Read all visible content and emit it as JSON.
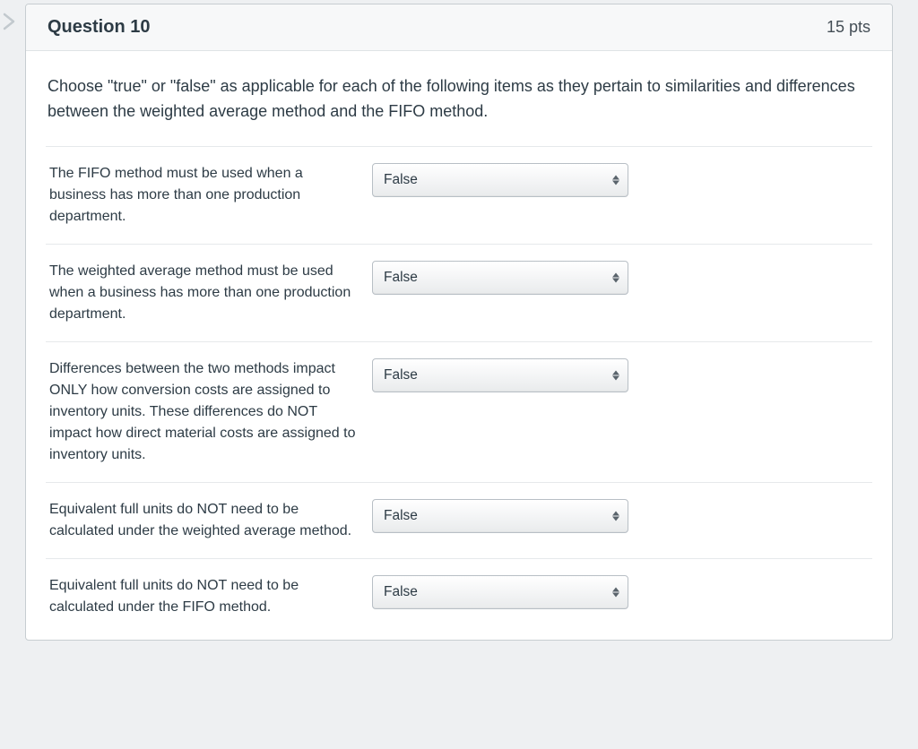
{
  "question": {
    "title": "Question 10",
    "points": "15 pts",
    "instructions": "Choose \"true\" or \"false\" as applicable for each of the following items as they pertain to similarities and differences between the weighted average method and the FIFO method.",
    "items": [
      {
        "text": "The FIFO method must be used when a business has more than one production department.",
        "value": "False"
      },
      {
        "text": "The weighted average method must be used when a business has more than one production department.",
        "value": "False"
      },
      {
        "text": "Differences between the two methods impact ONLY how conversion costs are assigned to inventory units. These differences do NOT impact how direct material costs are assigned to inventory units.",
        "value": "False"
      },
      {
        "text": "Equivalent full units do NOT need to be calculated under the weighted average method.",
        "value": "False"
      },
      {
        "text": "Equivalent full units do NOT need to be calculated under the FIFO method.",
        "value": "False"
      }
    ]
  }
}
